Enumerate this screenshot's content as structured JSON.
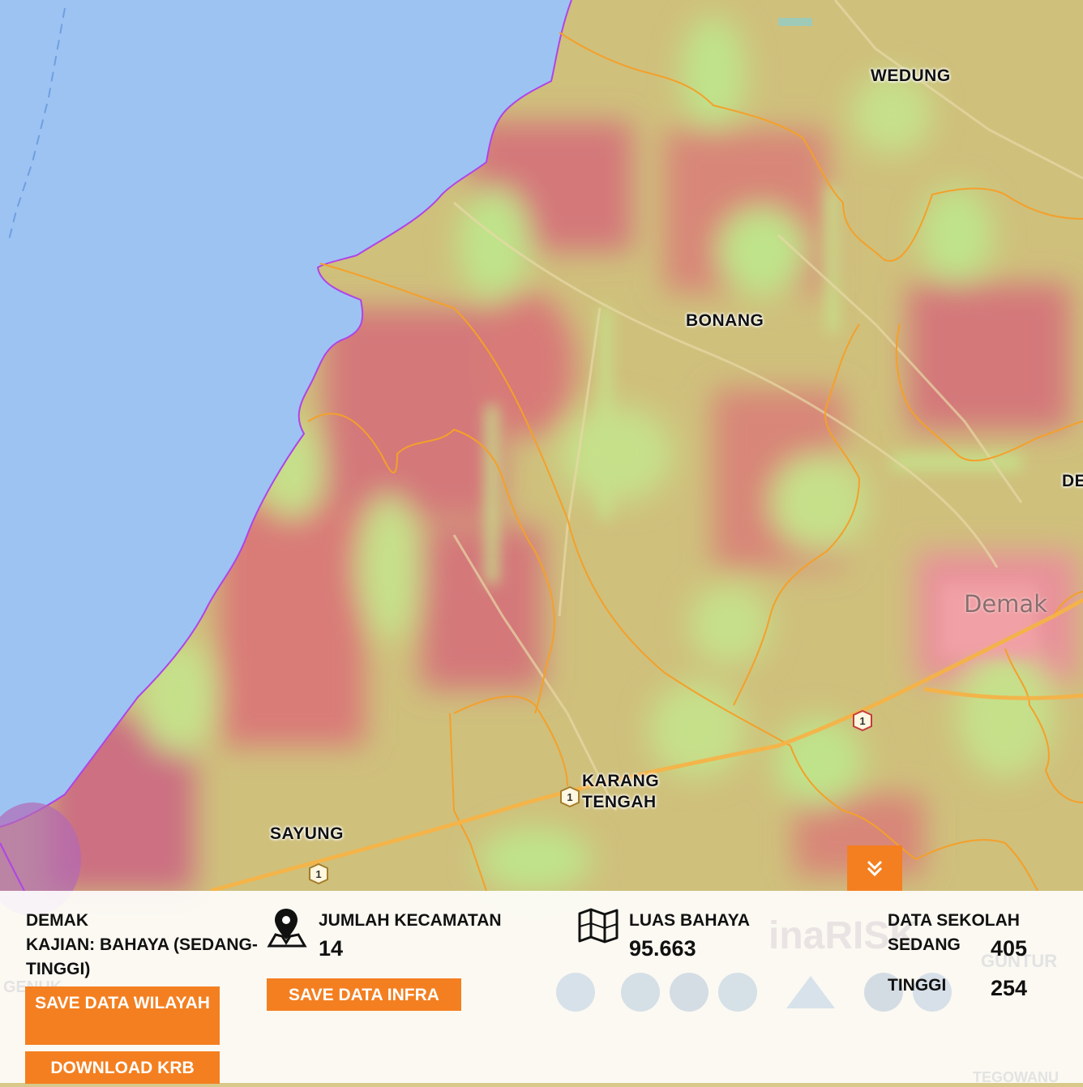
{
  "map": {
    "places": [
      {
        "key": "wedung",
        "name": "WEDUNG"
      },
      {
        "key": "bonang",
        "name": "BONANG"
      },
      {
        "key": "karang_tengah",
        "name": "KARANG\nTENGAH"
      },
      {
        "key": "sayung",
        "name": "SAYUNG"
      },
      {
        "key": "dempet",
        "name": "DE"
      }
    ],
    "city_label": "Demak",
    "road_shield": "1",
    "colors": {
      "sea": "#9dc3f3",
      "hazard_high": "#d4787a",
      "hazard_low": "#bfe38a",
      "admin_border": "#f4a02a",
      "coast": "#b044e8",
      "road": "#f5b347"
    }
  },
  "collapse_button": {
    "icon": "chevron-double-down-icon"
  },
  "panel": {
    "region": "DEMAK",
    "kajian_label": "KAJIAN: BAHAYA (SEDANG-TINGGI)",
    "save_wilayah": "SAVE DATA WILAYAH",
    "download_krb": "DOWNLOAD KRB",
    "kecamatan_label": "JUMLAH KECAMATAN",
    "kecamatan_value": "14",
    "kecamatan_icon": "map-pin-icon",
    "save_infra": "SAVE DATA INFRA",
    "luas_label": "LUAS BAHAYA",
    "luas_value": "95.663",
    "luas_icon": "folded-map-icon",
    "sekolah_label": "DATA SEKOLAH",
    "sedang_label": "SEDANG",
    "sedang_value": "405",
    "tinggi_label": "TINGGI",
    "tinggi_value": "254",
    "background_text": {
      "brand": "inaRISK",
      "guntur": "GUNTUR",
      "genuk": "GENUK",
      "tegowanu": "TEGOWANU"
    }
  }
}
